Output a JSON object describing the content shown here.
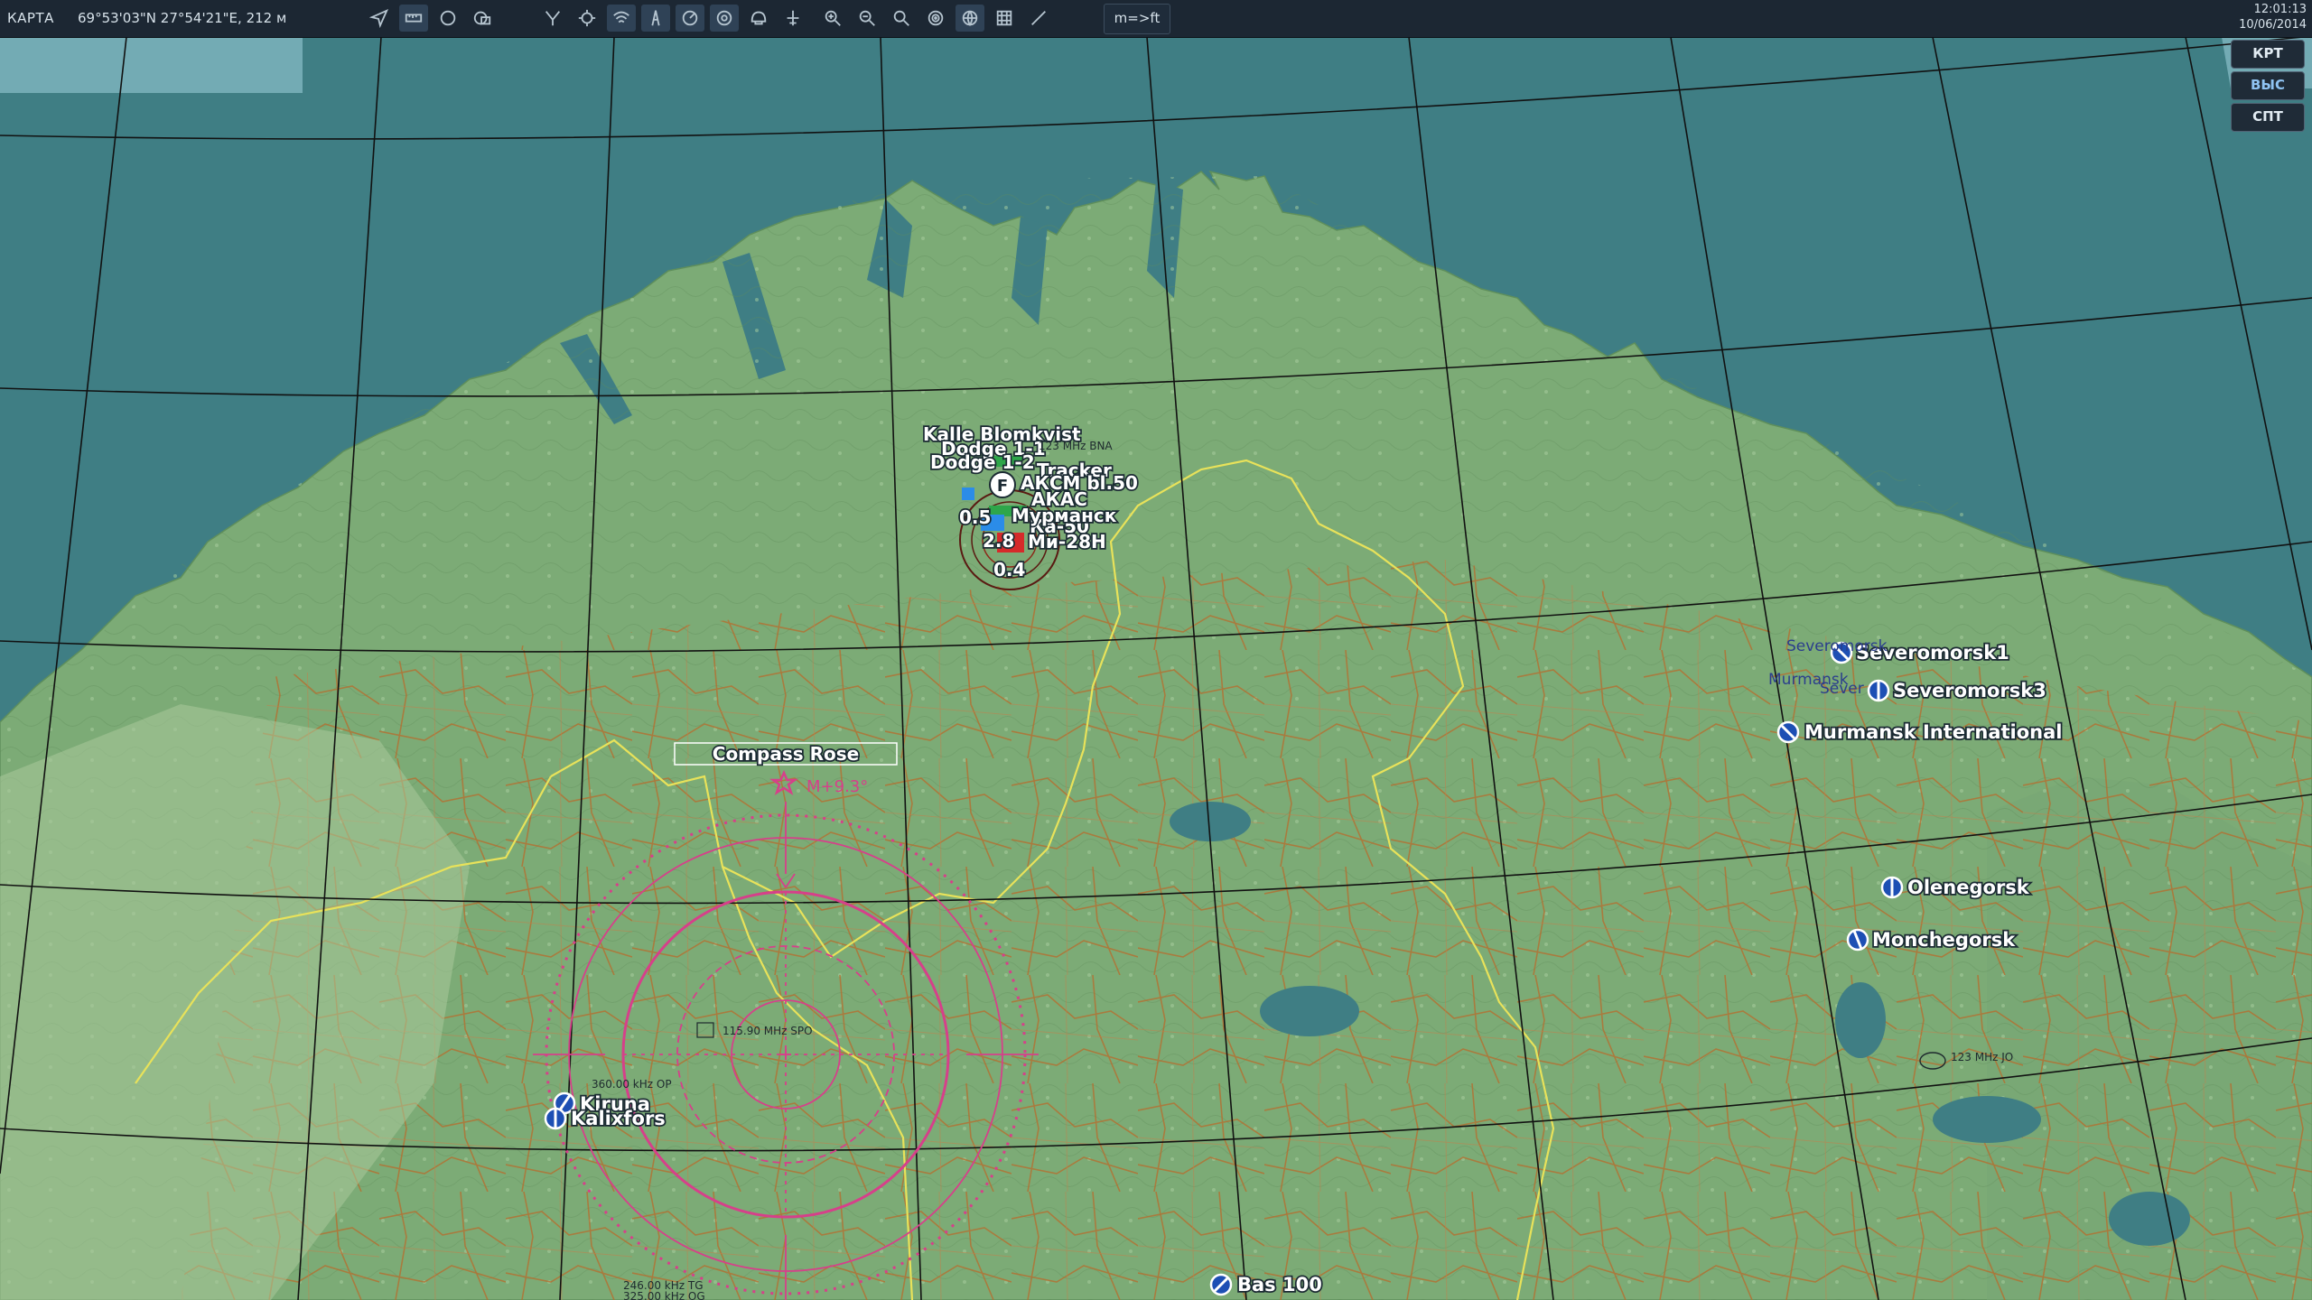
{
  "toolbar": {
    "mode_label": "КАРТА",
    "coordinates": "69°53'03\"N 27°54'21\"E, 212 м",
    "units_toggle": "m=>ft",
    "time": "12:01:13",
    "date": "10/06/2014",
    "icons": [
      "navigate-icon",
      "ruler-icon",
      "circle-icon",
      "layers-icon",
      "route-icon",
      "crosshair-icon",
      "signal-icon",
      "tower-icon",
      "radar-icon",
      "radar-zone-icon",
      "helmet-icon",
      "airport-icon",
      "zoom-in-icon",
      "zoom-out-icon",
      "zoom-fit-icon",
      "target-icon",
      "globe-icon",
      "grid-icon",
      "pencil-icon"
    ]
  },
  "side_buttons": [
    "КРТ",
    "ВЫС",
    "СПТ"
  ],
  "map": {
    "colors": {
      "sea": "#3f7e84",
      "land": "#7cab76",
      "roads": "#b5651d",
      "border": "#e8e25a",
      "rose": "#d6408a"
    },
    "airports": [
      "Severomorsk1",
      "Severomorsk3",
      "Murmansk International",
      "Olenegorsk",
      "Monchegorsk",
      "Kiruna",
      "Kalixfors",
      "Bas 100"
    ],
    "unit_labels": [
      "Kalle Blomkvist",
      "Dodge 1-1",
      "Dodge 1-2",
      "Tracker",
      "АКСМ bl.50",
      "АКАС",
      "2.8",
      "Ми-28Н",
      "Ка-50",
      "0.4",
      "0.5",
      "Мурманск"
    ],
    "compass_rose": {
      "title": "Compass Rose",
      "magvar": "M+9.3°"
    },
    "navaids": [
      "115.90 MHz SPO",
      "360.00 kHz OP",
      "246.00 kHz TG",
      "325.00 kHz OG",
      "123 MHz BNA",
      "123 MHz JO"
    ],
    "town_labels": [
      "Severomorsk",
      "Murmansk",
      "Sever"
    ]
  }
}
